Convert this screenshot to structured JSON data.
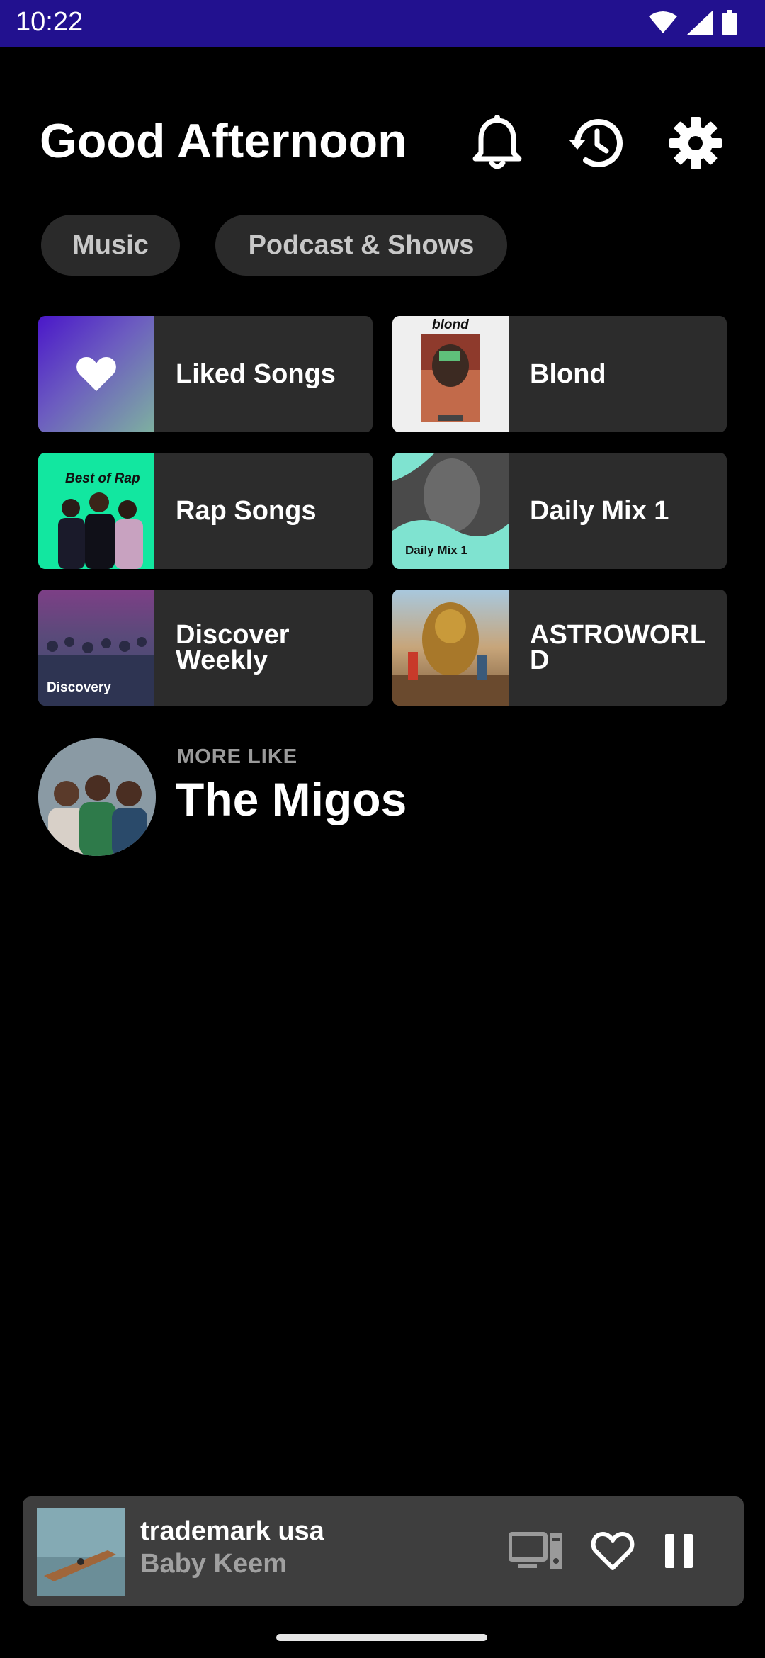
{
  "status_bar": {
    "time": "10:22",
    "bg_color": "#22118f"
  },
  "header": {
    "greeting": "Good Afternoon",
    "icons": [
      "bell-icon",
      "history-icon",
      "settings-icon"
    ]
  },
  "filters": [
    {
      "label": "Music"
    },
    {
      "label": "Podcast & Shows"
    }
  ],
  "shortcuts": [
    {
      "label": "Liked Songs",
      "art": "heart-icon"
    },
    {
      "label": "Blond",
      "art_text": "blond"
    },
    {
      "label": "Rap Songs",
      "art_text": "Best of Rap"
    },
    {
      "label": "Daily Mix 1",
      "art_text": "Daily Mix 1"
    },
    {
      "label": "Discover Weekly",
      "art_text": "Discovery"
    },
    {
      "label": "ASTROWORLD"
    }
  ],
  "more_like": {
    "kicker": "MORE LIKE",
    "title": "The Migos"
  },
  "now_playing": {
    "title": "trademark usa",
    "artist": "Baby Keem",
    "icons": [
      "devices-icon",
      "heart-outline-icon",
      "pause-icon"
    ]
  },
  "colors": {
    "background": "#000000",
    "tile": "#2c2c2c",
    "chip": "#2a2a2a",
    "player": "#3e3e3e"
  }
}
